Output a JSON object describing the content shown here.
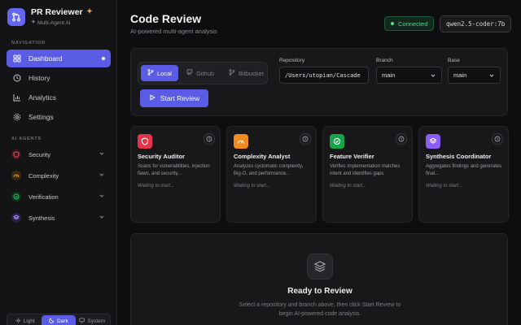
{
  "app": {
    "name": "PR Reviewer",
    "subtitle": "Multi-Agent AI"
  },
  "sidebar": {
    "navigation_label": "NAVIGATION",
    "nav_items": [
      {
        "label": "Dashboard",
        "icon": "dashboard-icon",
        "active": true
      },
      {
        "label": "History",
        "icon": "history-icon",
        "active": false
      },
      {
        "label": "Analytics",
        "icon": "analytics-icon",
        "active": false
      },
      {
        "label": "Settings",
        "icon": "settings-icon",
        "active": false
      }
    ],
    "agents_label": "AI AGENTS",
    "agents": [
      {
        "label": "Security",
        "icon": "shield-icon"
      },
      {
        "label": "Complexity",
        "icon": "gauge-icon"
      },
      {
        "label": "Verification",
        "icon": "check-circle-icon"
      },
      {
        "label": "Synthesis",
        "icon": "layers-icon"
      }
    ],
    "theme": {
      "options": [
        "Light",
        "Dark",
        "System"
      ],
      "selected": "Dark"
    }
  },
  "header": {
    "title": "Code Review",
    "subtitle": "AI-powered multi-agent analysis",
    "status": "Connected",
    "model": "qwen2.5-coder:7b"
  },
  "source_panel": {
    "sources": [
      {
        "label": "Local",
        "icon": "branch-icon",
        "active": true
      },
      {
        "label": "Github",
        "icon": "github-icon",
        "active": false
      },
      {
        "label": "Bitbucket",
        "icon": "bitbucket-icon",
        "active": false
      }
    ],
    "start_button": "Start Review",
    "repository_label": "Repository",
    "repository_value": "/Users/utopian/Cascade",
    "branch_label": "Branch",
    "branch_value": "main",
    "base_label": "Base",
    "base_value": "main"
  },
  "agent_cards": [
    {
      "title": "Security Auditor",
      "description": "Scans for vulnerabilities, injection flaws, and security...",
      "status": "Waiting to start...",
      "color": "#e5344a",
      "icon": "shield-icon"
    },
    {
      "title": "Complexity Analyst",
      "description": "Analyzes cyclomatic complexity, Big-O, and performance...",
      "status": "Waiting to start...",
      "color": "#f28a1c",
      "icon": "gauge-icon"
    },
    {
      "title": "Feature Verifier",
      "description": "Verifies implementation matches intent and identifies gaps",
      "status": "Waiting to start...",
      "color": "#16a34a",
      "icon": "check-circle-icon"
    },
    {
      "title": "Synthesis Coordinator",
      "description": "Aggregates findings and generates final...",
      "status": "Waiting to start...",
      "color": "#8b5cf6",
      "icon": "layers-icon"
    }
  ],
  "ready": {
    "title": "Ready to Review",
    "description": "Select a repository and branch above, then click Start Review to begin AI-powered code analysis."
  },
  "colors": {
    "accent": "#5b5ce6",
    "success": "#4ade80",
    "background": "#0e0e10",
    "sidebar": "#141416"
  }
}
